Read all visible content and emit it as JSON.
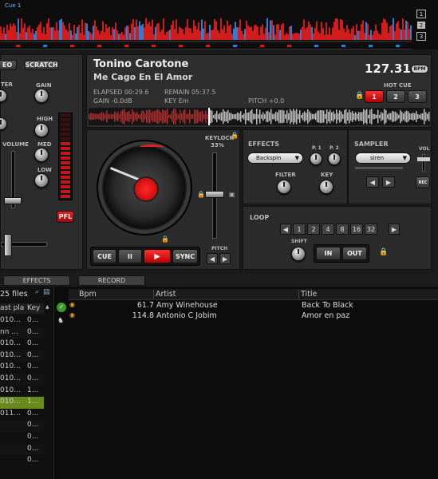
{
  "top": {
    "cue_marker": "Cue 1",
    "deck_numbers": [
      "1",
      "2",
      "3"
    ]
  },
  "mixer": {
    "video_tab": "EO",
    "scratch_tab": "SCRATCH",
    "knob_labels": {
      "filter": "TER",
      "gain": "GAIN",
      "high": "HIGH",
      "med": "MED",
      "low": "LOW"
    },
    "volume_label": "VOLUME",
    "pfl_label": "PFL"
  },
  "deck": {
    "artist": "Tonino Carotone",
    "title": "Me Cago En El Amor",
    "bpm": "127.31",
    "bpm_button": "BPM",
    "elapsed": "ELAPSED 00:29.6",
    "remain": "REMAIN 05:37.5",
    "gain": "GAIN -0.0dB",
    "key": "KEY Em",
    "pitch": "PITCH +0.0",
    "hot_cue_label": "HOT CUE",
    "hot_cues": [
      "1",
      "2",
      "3"
    ],
    "keylock_label": "KEYLOCK",
    "keylock_percent": "33%",
    "pitch_label": "PITCH",
    "transport": {
      "cue": "CUE",
      "pause": "II",
      "sync": "SYNC"
    }
  },
  "effects": {
    "label": "EFFECTS",
    "selected": "Backspin",
    "p1": "P. 1",
    "p2": "P. 2",
    "filter": "FILTER",
    "key": "KEY"
  },
  "sampler": {
    "label": "SAMPLER",
    "selected": "siren",
    "vol": "VOL",
    "rec": "REC"
  },
  "loop": {
    "label": "LOOP",
    "sizes": [
      "1",
      "2",
      "4",
      "8",
      "16",
      "32"
    ],
    "shift": "SHIFT",
    "in": "IN",
    "out": "OUT"
  },
  "tabs": {
    "effects": "EFFECTS",
    "record": "RECORD"
  },
  "browser": {
    "files_count": "25 files",
    "left_headers": [
      "ast pla",
      "Key"
    ],
    "left_rows": [
      [
        "010...",
        "0..."
      ],
      [
        "nn ...",
        "0..."
      ],
      [
        "010...",
        "0..."
      ],
      [
        "010...",
        "0..."
      ],
      [
        "010...",
        "0..."
      ],
      [
        "010...",
        "0..."
      ],
      [
        "010...",
        "1..."
      ],
      [
        "010...",
        "1..."
      ],
      [
        "011...",
        "0..."
      ],
      [
        "",
        "0..."
      ],
      [
        "",
        "0..."
      ],
      [
        "",
        "0..."
      ],
      [
        "",
        "0..."
      ]
    ],
    "headers": [
      "Bpm",
      "Artist",
      "Title"
    ],
    "rows": [
      {
        "bpm": "61.7",
        "artist": "Amy Winehouse",
        "title": "Back To Black"
      },
      {
        "bpm": "114.8",
        "artist": "Antonio C Jobim",
        "title": "Amor en paz"
      }
    ]
  },
  "colors": {
    "accent_red": "#e01010",
    "highlight_green": "#6a8a1a",
    "waveform_red": "#d21b1b",
    "waveform_blue": "#2a7fd4"
  }
}
